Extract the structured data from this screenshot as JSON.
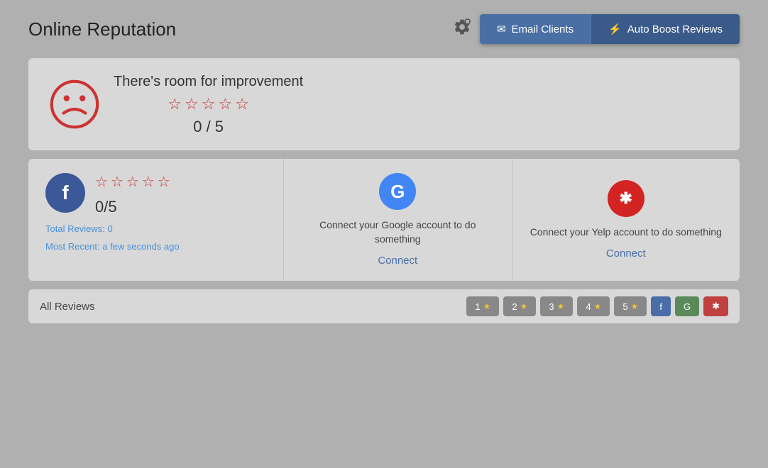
{
  "header": {
    "title": "Online Reputation",
    "settings_label": "settings",
    "email_clients_label": "Email Clients",
    "auto_boost_label": "Auto Boost Reviews"
  },
  "top_summary": {
    "message": "There's room for improvement",
    "score": "0 / 5",
    "stars_count": 5
  },
  "facebook_panel": {
    "score": "0/5",
    "total_reviews_label": "Total Reviews:",
    "total_reviews_value": "0",
    "most_recent_label": "Most Recent:",
    "most_recent_value": "a few seconds ago"
  },
  "google_panel": {
    "connect_text": "Connect your Google account to do something",
    "connect_label": "Connect"
  },
  "yelp_panel": {
    "connect_text": "Connect your Yelp account to do something",
    "connect_label": "Connect"
  },
  "reviews_bar": {
    "label": "All Reviews",
    "filters": [
      {
        "label": "1",
        "has_star": true
      },
      {
        "label": "2",
        "has_star": true
      },
      {
        "label": "3",
        "has_star": true
      },
      {
        "label": "4",
        "has_star": true
      },
      {
        "label": "5",
        "has_star": true
      },
      {
        "label": "f",
        "has_star": false,
        "type": "facebook"
      },
      {
        "label": "G",
        "has_star": false,
        "type": "google"
      },
      {
        "label": "y",
        "has_star": false,
        "type": "yelp"
      }
    ]
  }
}
